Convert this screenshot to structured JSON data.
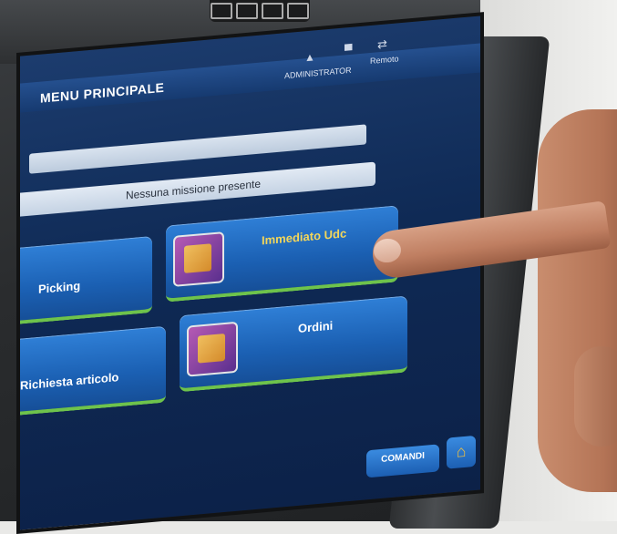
{
  "header": {
    "title": "MENU PRINCIPALE",
    "user": "ADMINISTRATOR",
    "remote_label": "Remoto"
  },
  "status": {
    "message": "Nessuna missione presente"
  },
  "buttons": [
    {
      "label": "Picking"
    },
    {
      "label": "Immediato Udc"
    },
    {
      "label": "Richiesta articolo"
    },
    {
      "label": "Ordini"
    }
  ],
  "footer": {
    "commands_label": "COMANDI",
    "home_icon": "home-icon"
  },
  "colors": {
    "screen_bg": "#0f2a55",
    "button_bg": "#1b60b3",
    "button_underline": "#6ec34c",
    "highlight_text": "#f4d75a"
  }
}
